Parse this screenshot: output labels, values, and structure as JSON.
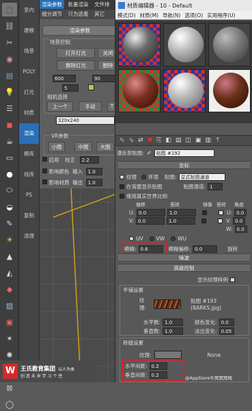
{
  "render_panel": {
    "tabs": [
      "渲染参数",
      "批量渲染",
      "文件排"
    ],
    "tabs2": [
      "细分调节",
      "只为选着",
      "其它"
    ],
    "section_title": "渲染参数",
    "field_control": "场景控制",
    "btn_light_on": "打开灯光",
    "btn_light_off": "关闭",
    "btn_del_light": "删除灯光",
    "btn_del": "删除",
    "val_600": "600",
    "val_90": "90",
    "val_5": "5",
    "camera_select": "相机选择",
    "btn_prev": "上一个",
    "btn_manual": "手动",
    "btn_t": "T",
    "resolution": "320x240",
    "vr_params": "VR参数",
    "btn_small": "小图",
    "btn_medium": "中图",
    "btn_large": "大图",
    "chk_enable": "启用",
    "lbl_correct": "校正",
    "val_correct": "2.2",
    "chk_color": "影响颜色",
    "lbl_input": "输入",
    "val_input": "1.0",
    "chk_material": "影响材质",
    "lbl_output": "输出",
    "val_output": "1.0"
  },
  "sidebar": {
    "items": [
      "室内",
      "建模",
      "场景",
      "POLY",
      "灯光",
      "材质",
      "渲染",
      "模库",
      "线库",
      "PS",
      "复制",
      "清理"
    ],
    "active_index": 6
  },
  "logo": {
    "company": "王氏教育集团",
    "tagline": "以人为本",
    "sub": "创 造 未 来 学 习 个 性"
  },
  "material_editor": {
    "title": "材质编辑器 - 10 - Default",
    "menu": [
      "模式(D)",
      "材质(M)",
      "导航(N)",
      "选项(O)",
      "实用程序(U)"
    ],
    "map_label": "漫反射贴图:",
    "map_name": "贴图 #192",
    "coords_rollout": "坐标",
    "radio_texture": "纹理",
    "radio_env": "环境",
    "lbl_map": "贴图:",
    "map_channel_type": "显式贴图通道",
    "chk_show_back": "在背面显示贴图",
    "lbl_map_channel": "贴图通道:",
    "val_map_channel": "1",
    "chk_real_world": "使用真实世界比例",
    "col_offset": "偏移",
    "col_tiling": "瓷砖",
    "col_mirror": "镜像",
    "col_tile": "瓷砖",
    "col_angle": "角度",
    "row_u": "U:",
    "row_v": "V:",
    "row_w": "W:",
    "u_offset": "0.0",
    "u_tiling": "1.0",
    "u_angle": "0.0",
    "v_offset": "0.0",
    "v_tiling": "1.0",
    "v_angle": "0.0",
    "w_angle": "0.0",
    "radio_uv": "UV",
    "radio_vw": "VW",
    "radio_wu": "WU",
    "lbl_blur": "模糊:",
    "val_blur": "0.6",
    "lbl_blur_offset": "模糊偏移:",
    "val_blur_offset": "0.0",
    "btn_rotate": "旋转",
    "noise_rollout": "噪波",
    "advanced_rollout": "高级控制",
    "chk_show_texture": "显示纹理样例",
    "tiles_section": "平铺设置",
    "lbl_texture": "纹理:",
    "texture_name": "贴图 #193 (BARKS.jpg)",
    "lbl_h_count": "水平数:",
    "val_h_count": "1.0",
    "lbl_v_count": "垂直数:",
    "val_v_count": "1.0",
    "lbl_color_var": "颜色变化:",
    "val_color_var": "0.0",
    "lbl_fade_var": "淡出变化:",
    "val_fade_var": "0.05",
    "grout_section": "砖缝设置",
    "lbl_grout_texture": "纹理:",
    "grout_none": "None",
    "lbl_h_gap": "水平间距:",
    "val_h_gap": "0.2",
    "lbl_v_gap": "垂直间距:",
    "val_v_gap": "0.2"
  },
  "watermark": "@AppStore牛窝窝窝网"
}
